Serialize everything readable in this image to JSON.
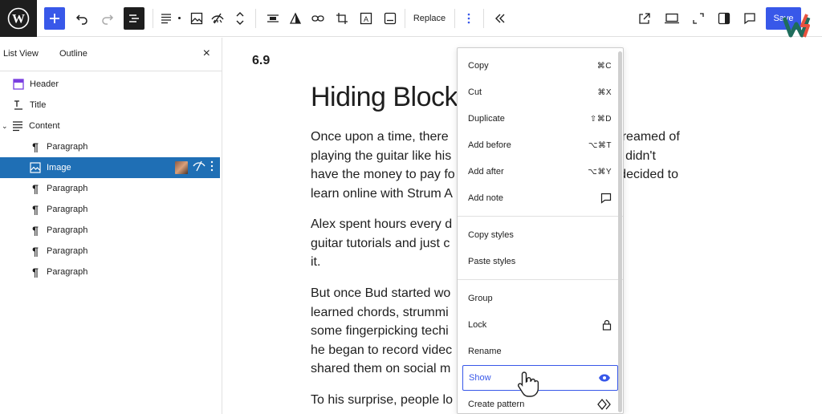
{
  "toolbar": {
    "replace_label": "Replace",
    "save_label": "Save"
  },
  "sidebar": {
    "tabs": [
      {
        "label": "List View"
      },
      {
        "label": "Outline"
      }
    ],
    "close_label": "×",
    "items": [
      {
        "label": "Header",
        "icon": "header-icon"
      },
      {
        "label": "Title",
        "icon": "title-icon"
      },
      {
        "label": "Content",
        "icon": "content-icon"
      },
      {
        "label": "Paragraph",
        "icon": "paragraph-icon"
      },
      {
        "label": "Image",
        "icon": "image-icon"
      },
      {
        "label": "Paragraph",
        "icon": "paragraph-icon"
      },
      {
        "label": "Paragraph",
        "icon": "paragraph-icon"
      },
      {
        "label": "Paragraph",
        "icon": "paragraph-icon"
      },
      {
        "label": "Paragraph",
        "icon": "paragraph-icon"
      },
      {
        "label": "Paragraph",
        "icon": "paragraph-icon"
      }
    ]
  },
  "canvas": {
    "version": "6.9",
    "title": "Hiding Block",
    "paragraphs": [
      {
        "lines": [
          "Once upon a time, there                                       who dreamed of",
          "playing the guitar like his                                     ver, he didn't",
          "have the money to pay fo                                      o he decided to",
          "learn online with Strum A"
        ]
      },
      {
        "lines": [
          "Alex spent hours every d",
          "guitar tutorials and just c",
          "it."
        ]
      },
      {
        "lines": [
          "But once Bud started wo",
          "learned chords, strummi",
          "some fingerpicking techi",
          "he began to record videc",
          "shared them on social m"
        ]
      },
      {
        "lines": [
          "To his surprise, people lo                                     getting"
        ]
      }
    ]
  },
  "menu": {
    "groups": [
      [
        {
          "label": "Copy",
          "shortcut": "⌘C"
        },
        {
          "label": "Cut",
          "shortcut": "⌘X"
        },
        {
          "label": "Duplicate",
          "shortcut": "⇧⌘D"
        },
        {
          "label": "Add before",
          "shortcut": "⌥⌘T"
        },
        {
          "label": "Add after",
          "shortcut": "⌥⌘Y"
        },
        {
          "label": "Add note",
          "shortcut": ""
        }
      ],
      [
        {
          "label": "Copy styles",
          "shortcut": ""
        },
        {
          "label": "Paste styles",
          "shortcut": ""
        }
      ],
      [
        {
          "label": "Group",
          "shortcut": ""
        },
        {
          "label": "Lock",
          "shortcut": ""
        },
        {
          "label": "Rename",
          "shortcut": ""
        },
        {
          "label": "Show",
          "shortcut": ""
        },
        {
          "label": "Create pattern",
          "shortcut": ""
        }
      ]
    ]
  },
  "colors": {
    "accent": "#3858e9",
    "selected_row": "#1f6fb5"
  }
}
